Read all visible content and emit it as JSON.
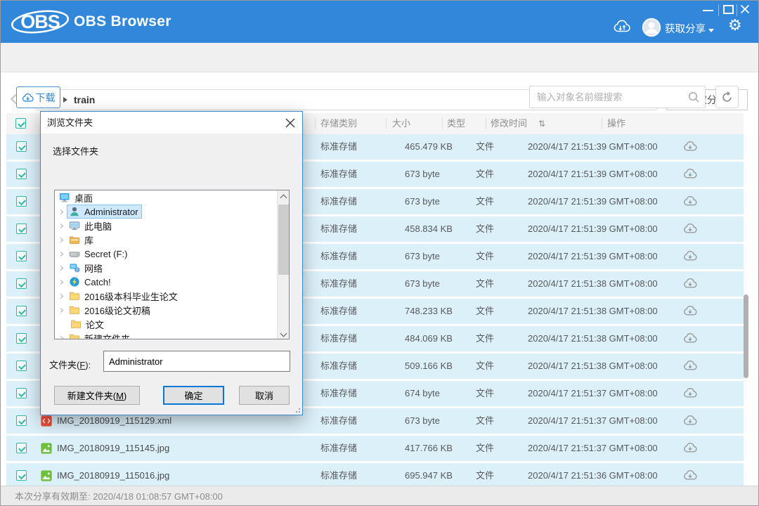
{
  "titlebar": {
    "logo_text": "OBS",
    "app_name": "OBS Browser",
    "share_label": "获取分享"
  },
  "icons": {
    "gear_glyph": "⚙",
    "sort_glyph": "⇅"
  },
  "pathbar": {
    "path_value": "train",
    "share_button": "获取分享"
  },
  "toolbar": {
    "download_label": "下载",
    "search_placeholder": "输入对象名前缀搜索"
  },
  "table": {
    "headers": {
      "storage": "存储类别",
      "size": "大小",
      "type": "类型",
      "modified": "修改时间",
      "operation": "操作"
    },
    "rows": [
      {
        "name": "",
        "icon": "",
        "storage": "标准存储",
        "size": "465.479 KB",
        "type": "文件",
        "modified": "2020/4/17 21:51:39 GMT+08:00"
      },
      {
        "name": "",
        "icon": "",
        "storage": "标准存储",
        "size": "673 byte",
        "type": "文件",
        "modified": "2020/4/17 21:51:39 GMT+08:00"
      },
      {
        "name": "",
        "icon": "",
        "storage": "标准存储",
        "size": "673 byte",
        "type": "文件",
        "modified": "2020/4/17 21:51:39 GMT+08:00"
      },
      {
        "name": "",
        "icon": "",
        "storage": "标准存储",
        "size": "458.834 KB",
        "type": "文件",
        "modified": "2020/4/17 21:51:39 GMT+08:00"
      },
      {
        "name": "",
        "icon": "",
        "storage": "标准存储",
        "size": "673 byte",
        "type": "文件",
        "modified": "2020/4/17 21:51:39 GMT+08:00"
      },
      {
        "name": "",
        "icon": "",
        "storage": "标准存储",
        "size": "673 byte",
        "type": "文件",
        "modified": "2020/4/17 21:51:38 GMT+08:00"
      },
      {
        "name": "",
        "icon": "",
        "storage": "标准存储",
        "size": "748.233 KB",
        "type": "文件",
        "modified": "2020/4/17 21:51:38 GMT+08:00"
      },
      {
        "name": "",
        "icon": "",
        "storage": "标准存储",
        "size": "484.069 KB",
        "type": "文件",
        "modified": "2020/4/17 21:51:38 GMT+08:00"
      },
      {
        "name": "",
        "icon": "",
        "storage": "标准存储",
        "size": "509.166 KB",
        "type": "文件",
        "modified": "2020/4/17 21:51:38 GMT+08:00"
      },
      {
        "name": "",
        "icon": "",
        "storage": "标准存储",
        "size": "674 byte",
        "type": "文件",
        "modified": "2020/4/17 21:51:37 GMT+08:00"
      },
      {
        "name": "IMG_20180919_115129.xml",
        "icon": "xml",
        "storage": "标准存储",
        "size": "673 byte",
        "type": "文件",
        "modified": "2020/4/17 21:51:37 GMT+08:00"
      },
      {
        "name": "IMG_20180919_115145.jpg",
        "icon": "image",
        "storage": "标准存储",
        "size": "417.766 KB",
        "type": "文件",
        "modified": "2020/4/17 21:51:37 GMT+08:00"
      },
      {
        "name": "IMG_20180919_115016.jpg",
        "icon": "image",
        "storage": "标准存储",
        "size": "695.947 KB",
        "type": "文件",
        "modified": "2020/4/17 21:51:36 GMT+08:00"
      }
    ]
  },
  "dialog": {
    "title": "浏览文件夹",
    "subtitle": "选择文件夹",
    "tree": [
      {
        "label": "桌面",
        "icon": "desktop",
        "expander": false,
        "selected": false,
        "indent": 0
      },
      {
        "label": "Administrator",
        "icon": "user",
        "expander": true,
        "selected": true,
        "indent": 1
      },
      {
        "label": "此电脑",
        "icon": "computer",
        "expander": true,
        "selected": false,
        "indent": 1
      },
      {
        "label": "库",
        "icon": "library",
        "expander": true,
        "selected": false,
        "indent": 1
      },
      {
        "label": "Secret (F:)",
        "icon": "drive",
        "expander": true,
        "selected": false,
        "indent": 1
      },
      {
        "label": "网络",
        "icon": "network",
        "expander": true,
        "selected": false,
        "indent": 1
      },
      {
        "label": "Catch!",
        "icon": "app",
        "expander": true,
        "selected": false,
        "indent": 1
      },
      {
        "label": "2016级本科毕业生论文",
        "icon": "folder",
        "expander": true,
        "selected": false,
        "indent": 1
      },
      {
        "label": "2016级论文初稿",
        "icon": "folder",
        "expander": true,
        "selected": false,
        "indent": 1
      },
      {
        "label": "论文",
        "icon": "folder",
        "expander": false,
        "selected": false,
        "indent": 1
      },
      {
        "label": "新建文件夹",
        "icon": "folder",
        "expander": true,
        "selected": false,
        "indent": 1
      }
    ],
    "folder_label_prefix": "文件夹(",
    "folder_label_key": "F",
    "folder_label_suffix": "):",
    "folder_value": "Administrator",
    "buttons": {
      "new_folder_prefix": "新建文件夹(",
      "new_folder_key": "M",
      "new_folder_suffix": ")",
      "ok": "确定",
      "cancel": "取消"
    }
  },
  "statusbar": {
    "text": "本次分享有效期至: 2020/4/18 01:08:57 GMT+08:00"
  },
  "colors": {
    "titlebar_blue": "#3187d9",
    "row_selected": "#dcf0fa",
    "checkbox_teal": "#30b8a6",
    "ok_button_border": "#0078d7",
    "dialog_border": "#3c86cf"
  }
}
